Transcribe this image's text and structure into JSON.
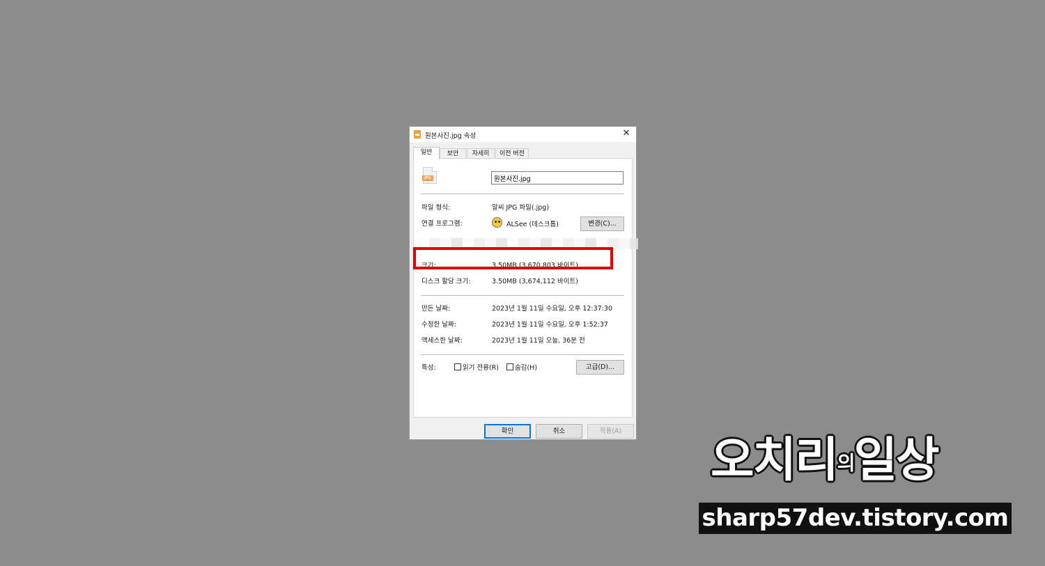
{
  "window": {
    "title": "원본사진.jpg 속성",
    "tabs": [
      "일반",
      "보안",
      "자세히",
      "이전 버전"
    ],
    "active_tab": "일반"
  },
  "general": {
    "file_icon_label": "JPG",
    "file_name": "원본사진.jpg",
    "file_type_label": "파일 형식:",
    "file_type_value": "알씨 JPG 파일(.jpg)",
    "opens_with_label": "연결 프로그램:",
    "opens_with_value": "ALSee (데스크톱)",
    "change_button": "변경(C)...",
    "size_label": "크기:",
    "size_value": "3.50MB (3,670,803 바이트)",
    "size_on_disk_label": "디스크 할당 크기:",
    "size_on_disk_value": "3.50MB (3,674,112 바이트)",
    "created_label": "만든 날짜:",
    "created_value": "2023년 1월 11일 수요일, 오후 12:37:30",
    "modified_label": "수정한 날짜:",
    "modified_value": "2023년 1월 11일 수요일, 오후 1:52:37",
    "accessed_label": "액세스한 날짜:",
    "accessed_value": "2023년 1월 11일 오늘, 36분 전",
    "attributes_label": "특성:",
    "readonly_label": "읽기 전용(R)",
    "hidden_label": "숨김(H)",
    "advanced_button": "고급(D)..."
  },
  "footer": {
    "ok": "확인",
    "cancel": "취소",
    "apply": "적용(A)"
  },
  "watermark": {
    "title_main": "오치리",
    "title_small": "의",
    "title_end": "일상",
    "url": "sharp57dev.tistory.com"
  },
  "colors": {
    "background": "#8c8c8c",
    "highlight": "#e00000",
    "ok_border": "#0078d7"
  }
}
